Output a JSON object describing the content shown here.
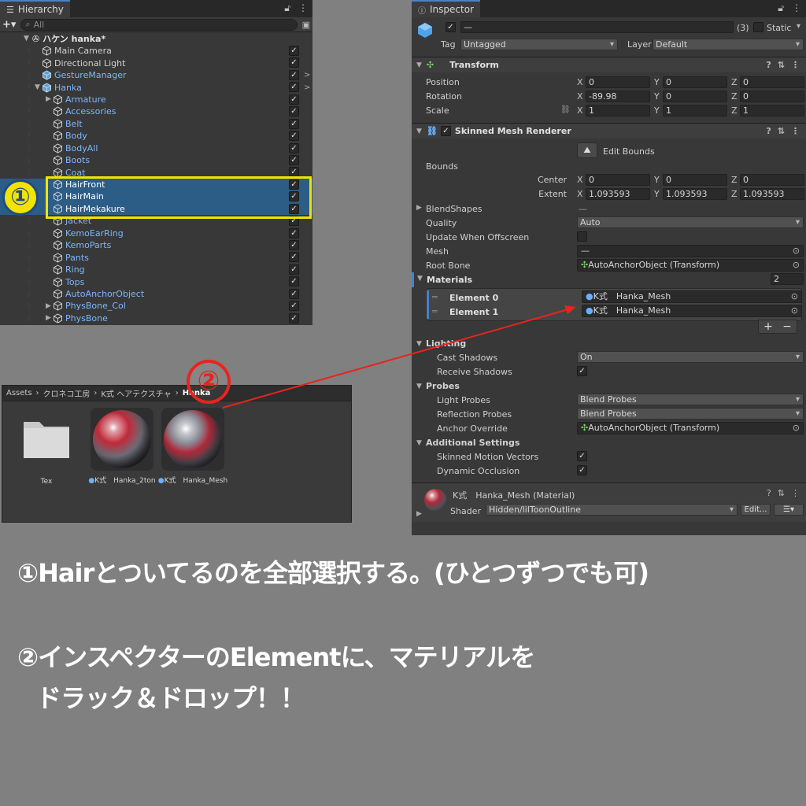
{
  "hierarchy": {
    "tab_title": "Hierarchy",
    "search_placeholder": "All",
    "add_label": "+▾",
    "scene_name": "ハケン hanka*",
    "items": [
      {
        "label": "Main Camera",
        "blue": false,
        "caret": "",
        "indent": 0
      },
      {
        "label": "Directional Light",
        "blue": false,
        "caret": "",
        "indent": 0
      },
      {
        "label": "GestureManager",
        "blue": true,
        "caret": "",
        "indent": 0,
        "arrow": ">"
      },
      {
        "label": "Hanka",
        "blue": true,
        "caret": "▼",
        "indent": 0,
        "arrow": ">"
      },
      {
        "label": "Armature",
        "blue": true,
        "caret": "▶",
        "indent": 1
      },
      {
        "label": "Accessories",
        "blue": true,
        "caret": "",
        "indent": 1
      },
      {
        "label": "Belt",
        "blue": true,
        "caret": "",
        "indent": 1
      },
      {
        "label": "Body",
        "blue": true,
        "caret": "",
        "indent": 1
      },
      {
        "label": "BodyAll",
        "blue": true,
        "caret": "",
        "indent": 1
      },
      {
        "label": "Boots",
        "blue": true,
        "caret": "",
        "indent": 1
      },
      {
        "label": "Coat",
        "blue": true,
        "caret": "",
        "indent": 1
      },
      {
        "label": "HairFront",
        "blue": true,
        "caret": "",
        "indent": 1,
        "selected": true
      },
      {
        "label": "HairMain",
        "blue": true,
        "caret": "",
        "indent": 1,
        "selected": true
      },
      {
        "label": "HairMekakure",
        "blue": true,
        "caret": "",
        "indent": 1,
        "selected": true
      },
      {
        "label": "Jacket",
        "blue": true,
        "caret": "",
        "indent": 1
      },
      {
        "label": "KemoEarRing",
        "blue": true,
        "caret": "",
        "indent": 1
      },
      {
        "label": "KemoParts",
        "blue": true,
        "caret": "",
        "indent": 1
      },
      {
        "label": "Pants",
        "blue": true,
        "caret": "",
        "indent": 1
      },
      {
        "label": "Ring",
        "blue": true,
        "caret": "",
        "indent": 1
      },
      {
        "label": "Tops",
        "blue": true,
        "caret": "",
        "indent": 1
      },
      {
        "label": "AutoAnchorObject",
        "blue": true,
        "caret": "",
        "indent": 1
      },
      {
        "label": "PhysBone_Col",
        "blue": true,
        "caret": "▶",
        "indent": 1
      },
      {
        "label": "PhysBone",
        "blue": true,
        "caret": "▶",
        "indent": 1
      }
    ]
  },
  "inspector": {
    "tab_title": "Inspector",
    "object_name": "—",
    "multi_count": "(3)",
    "static_label": "Static",
    "tag_label": "Tag",
    "tag_value": "Untagged",
    "layer_label": "Layer",
    "layer_value": "Default",
    "transform": {
      "title": "Transform",
      "position_label": "Position",
      "position": [
        "0",
        "0",
        "0"
      ],
      "rotation_label": "Rotation",
      "rotation": [
        "-89.98",
        "0",
        "0"
      ],
      "scale_label": "Scale",
      "scale": [
        "1",
        "1",
        "1"
      ],
      "axes": [
        "X",
        "Y",
        "Z"
      ]
    },
    "smr": {
      "title": "Skinned Mesh Renderer",
      "edit_bounds": "Edit Bounds",
      "bounds_label": "Bounds",
      "center_label": "Center",
      "center": [
        "0",
        "0",
        "0"
      ],
      "extent_label": "Extent",
      "extent": [
        "1.093593",
        "1.093593",
        "1.093593"
      ],
      "blendshapes_label": "BlendShapes",
      "blendshapes_value": "—",
      "quality_label": "Quality",
      "quality_value": "Auto",
      "update_offscreen_label": "Update When Offscreen",
      "mesh_label": "Mesh",
      "mesh_value": "—",
      "root_bone_label": "Root Bone",
      "root_bone_value": "AutoAnchorObject (Transform)",
      "materials_label": "Materials",
      "materials_count": "2",
      "element0_label": "Element 0",
      "element0_value": "K式　Hanka_Mesh",
      "element1_label": "Element 1",
      "element1_value": "K式　Hanka_Mesh",
      "lighting_label": "Lighting",
      "cast_shadows_label": "Cast Shadows",
      "cast_shadows_value": "On",
      "receive_shadows_label": "Receive Shadows",
      "probes_label": "Probes",
      "light_probes_label": "Light Probes",
      "light_probes_value": "Blend Probes",
      "reflection_probes_label": "Reflection Probes",
      "reflection_probes_value": "Blend Probes",
      "anchor_override_label": "Anchor Override",
      "anchor_override_value": "AutoAnchorObject (Transform)",
      "additional_label": "Additional Settings",
      "skinned_motion_label": "Skinned Motion Vectors",
      "dynamic_occlusion_label": "Dynamic Occlusion"
    },
    "material": {
      "name": "K式　Hanka_Mesh (Material)",
      "shader_label": "Shader",
      "shader_value": "Hidden/lilToonOutline",
      "edit_label": "Edit..."
    }
  },
  "project": {
    "breadcrumb": [
      "Assets",
      "クロネコ工房",
      "K式 ヘアテクスチャ",
      "Hanka"
    ],
    "assets": [
      {
        "label": "Tex",
        "kind": "folder"
      },
      {
        "label": "K式　Hanka_2ton",
        "kind": "material"
      },
      {
        "label": "K式　Hanka_Mesh",
        "kind": "material"
      }
    ]
  },
  "annotations": {
    "badge1": "①",
    "badge2": "②",
    "line1": "①Hairとついてるのを全部選択する。(ひとつずつでも可)",
    "line2": "②インスペクターのElementに、マテリアルを",
    "line3": "ドラック＆ドロップ！！",
    "highlight_color": "#f2e300",
    "arrow_color": "#e8241e"
  }
}
